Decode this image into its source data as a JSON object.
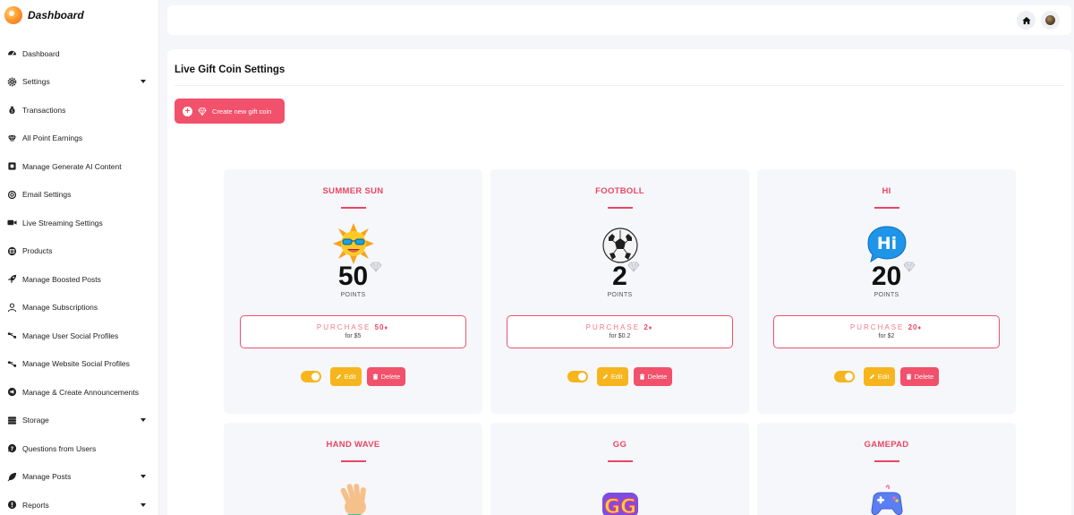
{
  "brand": {
    "title": "Dashboard"
  },
  "sidebar": {
    "items": [
      {
        "label": "Dashboard",
        "icon": "dashboard-icon",
        "has_caret": false
      },
      {
        "label": "Settings",
        "icon": "gear-icon",
        "has_caret": true
      },
      {
        "label": "Transactions",
        "icon": "money-bag-icon",
        "has_caret": false
      },
      {
        "label": "All Point Earnings",
        "icon": "diamond-icon",
        "has_caret": false
      },
      {
        "label": "Manage Generate AI Content",
        "icon": "ai-chip-icon",
        "has_caret": false
      },
      {
        "label": "Email Settings",
        "icon": "at-sign-icon",
        "has_caret": false
      },
      {
        "label": "Live Streaming Settings",
        "icon": "video-camera-icon",
        "has_caret": false
      },
      {
        "label": "Products",
        "icon": "product-box-icon",
        "has_caret": false
      },
      {
        "label": "Manage Boosted Posts",
        "icon": "rocket-icon",
        "has_caret": false
      },
      {
        "label": "Manage Subscriptions",
        "icon": "users-icon",
        "has_caret": false
      },
      {
        "label": "Manage User Social Profiles",
        "icon": "share-icon",
        "has_caret": false
      },
      {
        "label": "Manage Website Social Profiles",
        "icon": "share-icon",
        "has_caret": false
      },
      {
        "label": "Manage & Create Announcements",
        "icon": "megaphone-icon",
        "has_caret": false
      },
      {
        "label": "Storage",
        "icon": "database-icon",
        "has_caret": true
      },
      {
        "label": "Questions from Users",
        "icon": "question-icon",
        "has_caret": false
      },
      {
        "label": "Manage Posts",
        "icon": "feather-icon",
        "has_caret": true
      },
      {
        "label": "Reports",
        "icon": "alert-circle-icon",
        "has_caret": true
      }
    ]
  },
  "topbar": {
    "home_icon": "home-icon",
    "avatar_icon": "avatar"
  },
  "main": {
    "title": "Live Gift Coin Settings",
    "create_button": "Create new gift coin",
    "colors": {
      "accent": "#f1516b",
      "warning": "#f6b51c",
      "title_red": "#e94763"
    },
    "cards": [
      {
        "name": "SUMMER SUN",
        "emoji": "sun-with-sunglasses-icon",
        "points": "50",
        "unit": "POINTS",
        "purchase_label": "PURCHASE",
        "purchase_points": "50",
        "price": "for $5",
        "enabled": true,
        "edit_label": "Edit",
        "delete_label": "Delete"
      },
      {
        "name": "FOOTBOLL",
        "emoji": "soccer-ball-icon",
        "points": "2",
        "unit": "POINTS",
        "purchase_label": "PURCHASE",
        "purchase_points": "2",
        "price": "for $0.2",
        "enabled": true,
        "edit_label": "Edit",
        "delete_label": "Delete"
      },
      {
        "name": "HI",
        "emoji": "hi-speech-bubble-icon",
        "points": "20",
        "unit": "POINTS",
        "purchase_label": "PURCHASE",
        "purchase_points": "20",
        "price": "for $2",
        "enabled": true,
        "edit_label": "Edit",
        "delete_label": "Delete"
      },
      {
        "name": "HAND WAVE",
        "emoji": "waving-hand-icon"
      },
      {
        "name": "GG",
        "emoji": "gg-text-icon"
      },
      {
        "name": "GAMEPAD",
        "emoji": "gamepad-icon"
      }
    ]
  }
}
